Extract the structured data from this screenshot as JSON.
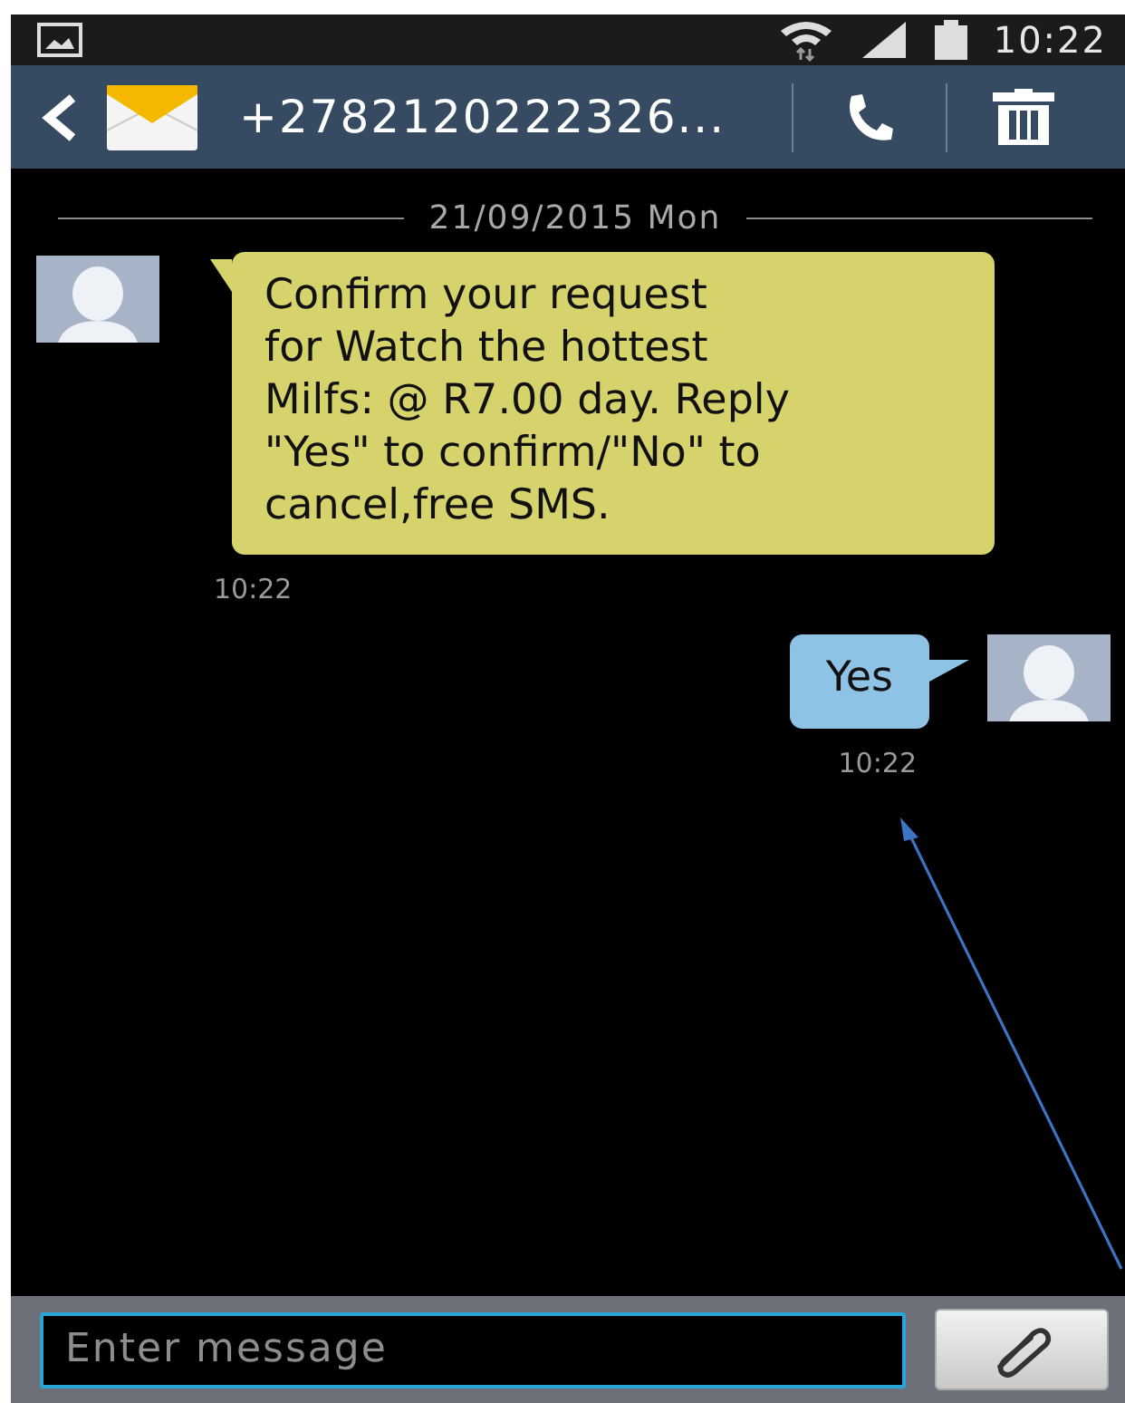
{
  "status_bar": {
    "time": "10:22"
  },
  "header": {
    "contact": "+2782120222326..."
  },
  "thread": {
    "date": "21/09/2015 Mon",
    "messages": [
      {
        "kind": "incoming",
        "text": "Confirm your request\nfor Watch the hottest\nMilfs: @ R7.00 day. Reply\n\"Yes\" to confirm/\"No\" to\ncancel,free SMS.",
        "time": "10:22"
      },
      {
        "kind": "outgoing",
        "text": "Yes",
        "time": "10:22"
      }
    ]
  },
  "composer": {
    "placeholder": "Enter message"
  }
}
